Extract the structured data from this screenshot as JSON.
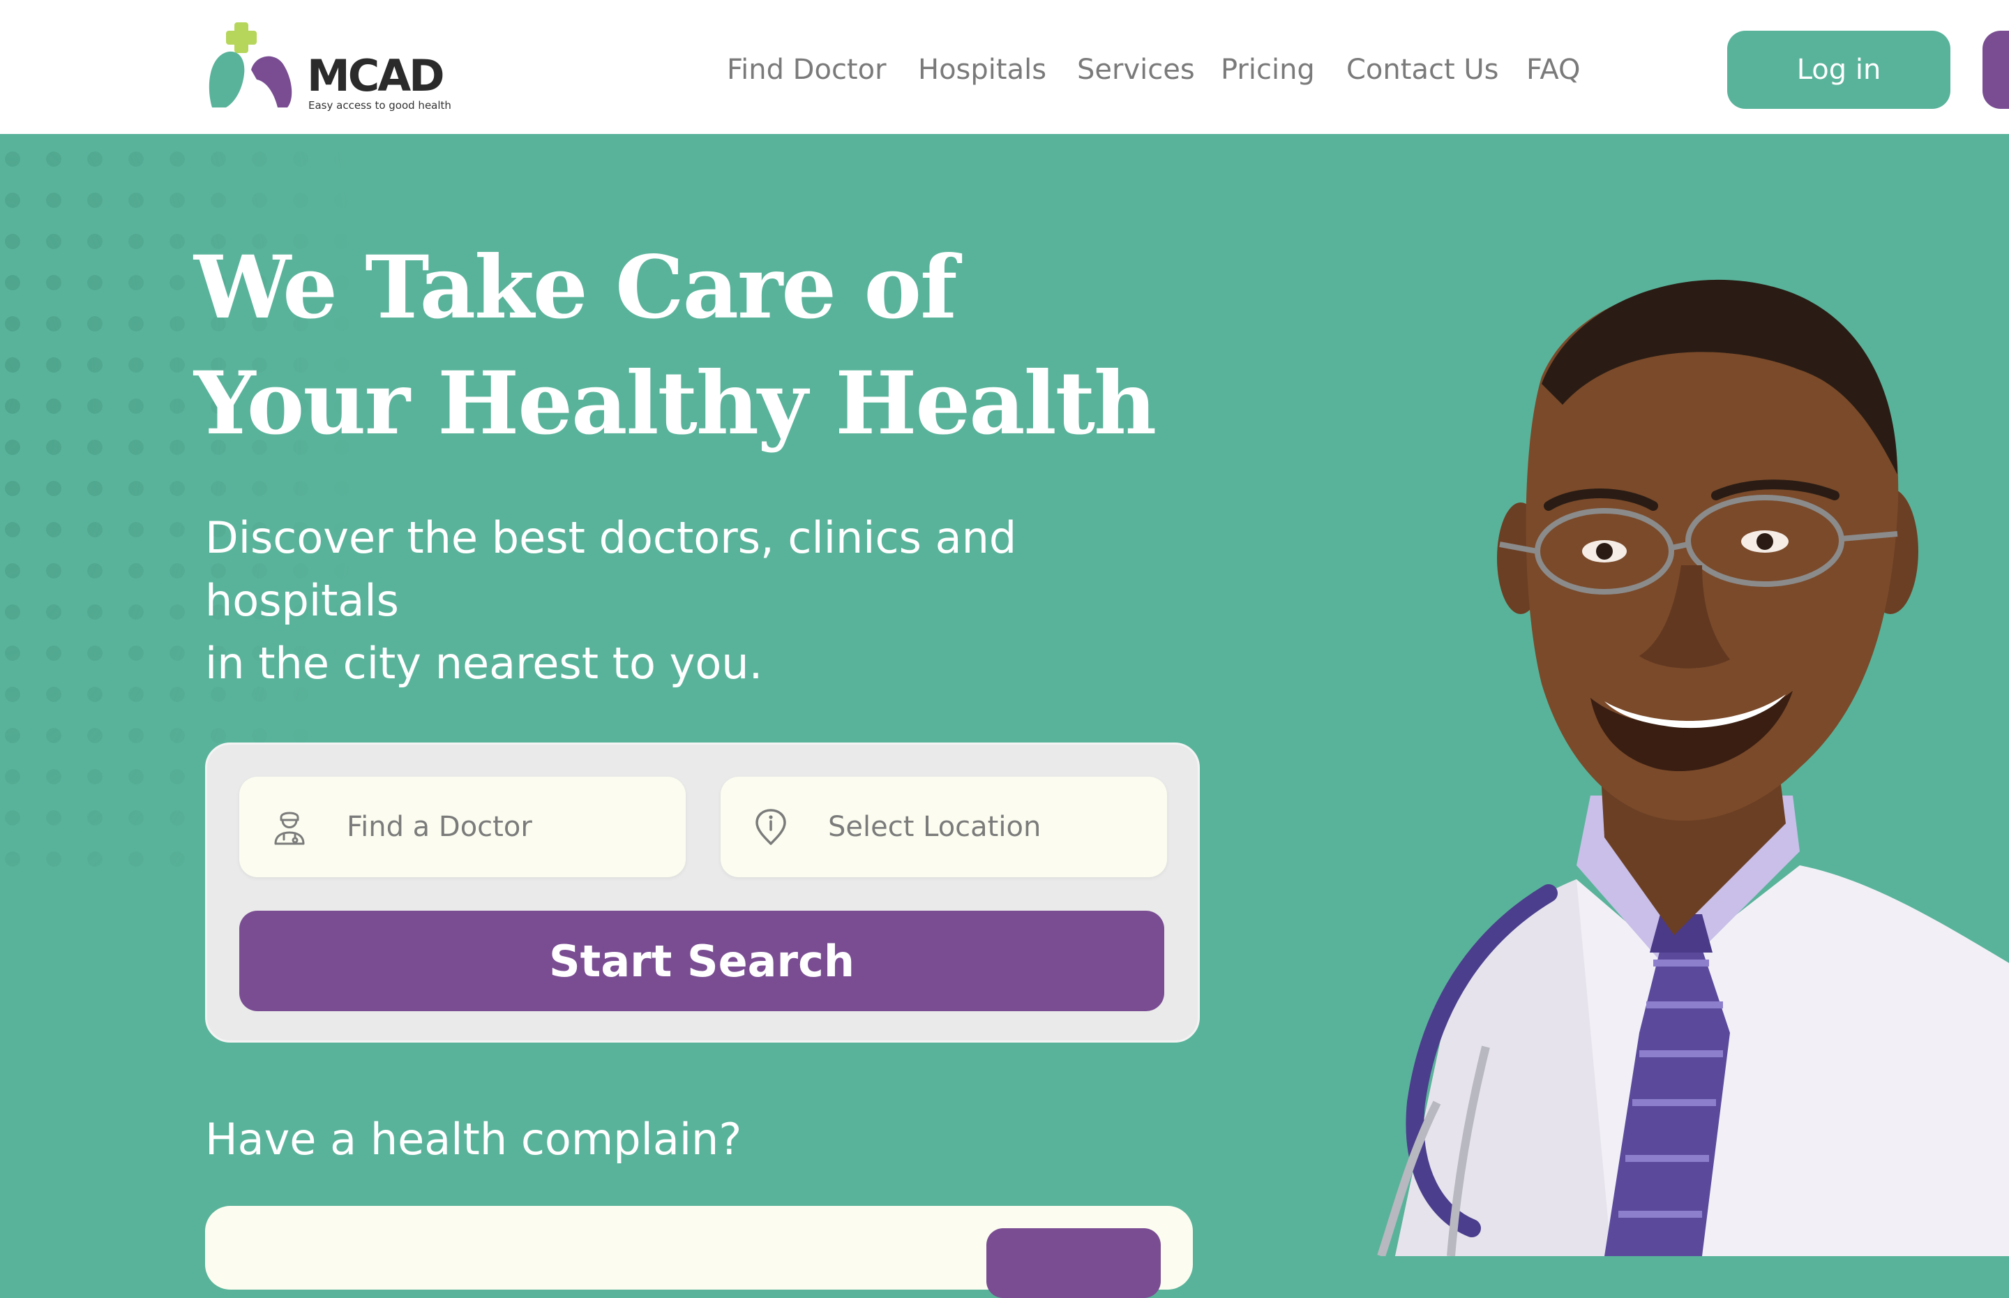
{
  "brand": {
    "name": "MCAD",
    "tagline": "Easy access to good health",
    "colors": {
      "green": "#59B39A",
      "purple": "#7A4D93",
      "lime": "#B5D65A"
    }
  },
  "nav": {
    "items": [
      {
        "label": "Find Doctor"
      },
      {
        "label": "Hospitals"
      },
      {
        "label": "Services"
      },
      {
        "label": "Pricing"
      },
      {
        "label": "Contact Us"
      },
      {
        "label": "FAQ"
      }
    ],
    "login_label": "Log in"
  },
  "hero": {
    "title_line1": "We Take Care of",
    "title_line2": "Your Healthy Health",
    "subtitle_line1": "Discover the best doctors, clinics and hospitals",
    "subtitle_line2": "in the city nearest to you."
  },
  "search": {
    "doctor_placeholder": "Find a Doctor",
    "doctor_icon": "doctor-icon",
    "location_placeholder": "Select Location",
    "location_icon": "location-pin-icon",
    "button_label": "Start Search"
  },
  "complaint": {
    "label": "Have a health complain?"
  }
}
